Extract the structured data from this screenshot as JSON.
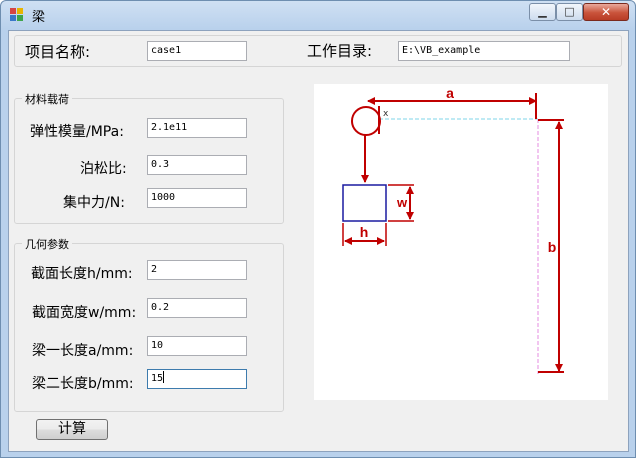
{
  "window": {
    "title": "梁",
    "blurred_title": "",
    "controls": {
      "minimize_glyph": "▁",
      "maximize_glyph": "□",
      "close_glyph": "✕"
    }
  },
  "project": {
    "name_label": "项目名称:",
    "name_value": "case1",
    "dir_label": "工作目录:",
    "dir_value": "E:\\VB_example"
  },
  "material": {
    "group_title": "材料载荷",
    "fields": [
      {
        "label": "弹性模量/MPa:",
        "value": "2.1e11"
      },
      {
        "label": "泊松比:",
        "value": "0.3"
      },
      {
        "label": "集中力/N:",
        "value": "1000"
      }
    ]
  },
  "geometry": {
    "group_title": "几何参数",
    "fields": [
      {
        "label": "截面长度h/mm:",
        "value": "2"
      },
      {
        "label": "截面宽度w/mm:",
        "value": "0.2"
      },
      {
        "label": "梁一长度a/mm:",
        "value": "10"
      },
      {
        "label": "梁二长度b/mm:",
        "value": "15"
      }
    ]
  },
  "compute_button": "计算",
  "diagram": {
    "label_a": "a",
    "label_b": "b",
    "label_w": "w",
    "label_h": "h",
    "label_x": "x",
    "colors": {
      "arrow": "#c00000",
      "circle": "#c00000",
      "section": "#1a1aa0",
      "dash_cyan": "#7fd6e8",
      "dash_pink": "#e58ee0"
    }
  }
}
